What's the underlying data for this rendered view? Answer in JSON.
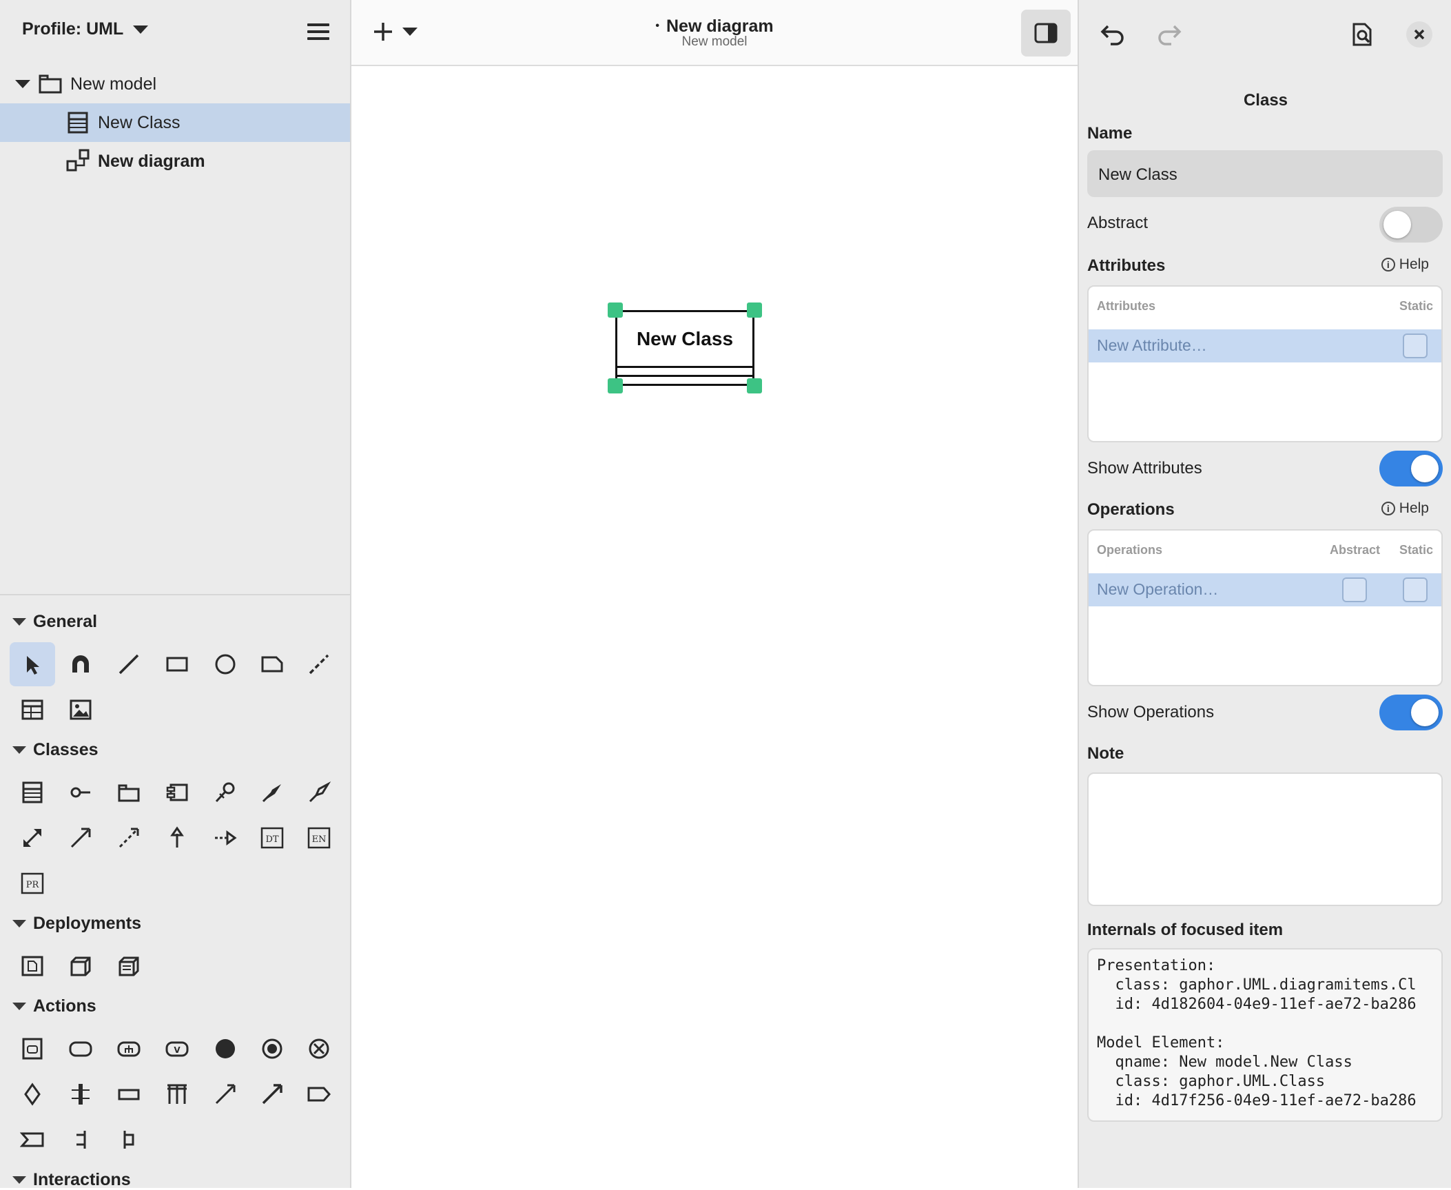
{
  "left_pane": {
    "profile_label": "Profile: UML",
    "tree": [
      {
        "label": "New model",
        "icon": "package-icon",
        "expanded": true
      },
      {
        "label": "New Class",
        "icon": "class-icon",
        "selected": true
      },
      {
        "label": "New diagram",
        "icon": "diagram-icon",
        "bold": true
      }
    ],
    "palette": {
      "general": "General",
      "classes": "Classes",
      "deployments": "Deployments",
      "actions": "Actions",
      "interactions": "Interactions"
    }
  },
  "center": {
    "title": "New diagram",
    "subtitle": "New model",
    "modified_dot": "•",
    "diagram": {
      "class_name": "New Class"
    }
  },
  "right_pane": {
    "heading": "Class",
    "name_label": "Name",
    "name_value": "New Class",
    "abstract_label": "Abstract",
    "abstract_on": false,
    "attributes_title": "Attributes",
    "help_label": "Help",
    "attributes_col": "Attributes",
    "static_col": "Static",
    "new_attribute": "New Attribute…",
    "show_attributes_label": "Show Attributes",
    "show_attributes_on": true,
    "operations_title": "Operations",
    "operations_col": "Operations",
    "abstract_col": "Abstract",
    "new_operation": "New Operation…",
    "show_operations_label": "Show Operations",
    "show_operations_on": true,
    "note_title": "Note",
    "internals_title": "Internals of focused item",
    "internals_text": "Presentation:\n  class: gaphor.UML.diagramitems.Cl\n  id: 4d182604-04e9-11ef-ae72-ba286\n\nModel Element:\n  qname: New model.New Class\n  class: gaphor.UML.Class\n  id: 4d17f256-04e9-11ef-ae72-ba286"
  },
  "colors": {
    "accent": "#3584e4",
    "selection": "#c3d4ea",
    "handle": "#3dc384"
  }
}
